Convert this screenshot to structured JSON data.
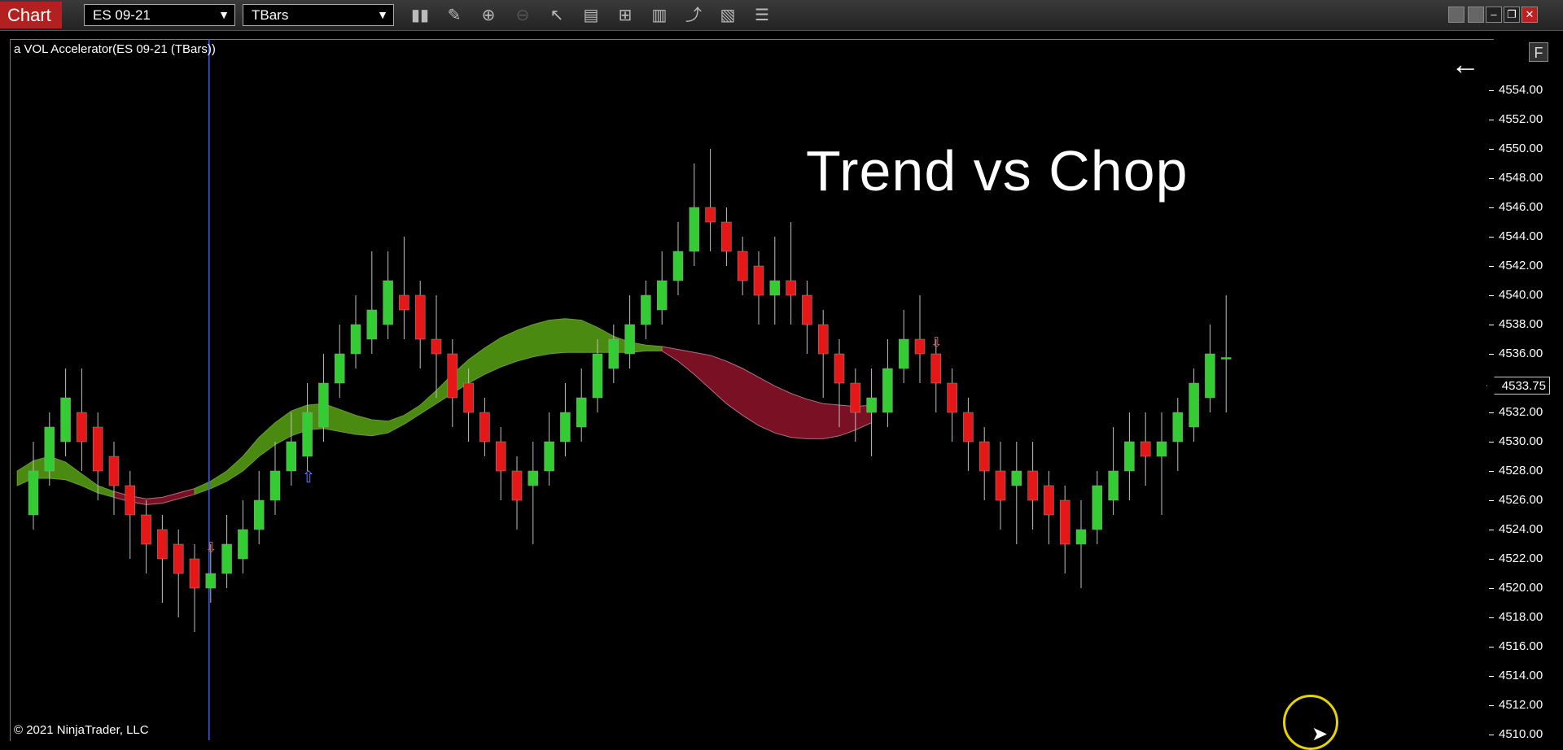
{
  "titlebar": {
    "chart_tab": "Chart",
    "instrument": "ES 09-21",
    "bar_type": "TBars",
    "tools": [
      "bar-style-icon",
      "draw-pencil-icon",
      "zoom-in-icon",
      "zoom-out-icon",
      "pointer-icon",
      "data-box-icon",
      "properties-icon",
      "chart-style-icon",
      "indicators-icon",
      "strategies-icon",
      "menu-lines-icon"
    ]
  },
  "indicator_label": "a VOL Accelerator(ES 09-21 (TBars))",
  "copyright": "© 2021 NinjaTrader, LLC",
  "main_title": "Trend vs Chop",
  "f_button": "F",
  "price_axis": {
    "ticks": [
      "4554.00",
      "4552.00",
      "4550.00",
      "4548.00",
      "4546.00",
      "4544.00",
      "4542.00",
      "4540.00",
      "4538.00",
      "4536.00",
      "4534.00",
      "4532.00",
      "4530.00",
      "4528.00",
      "4526.00",
      "4524.00",
      "4522.00",
      "4520.00",
      "4518.00",
      "4516.00",
      "4514.00",
      "4512.00",
      "4510.00"
    ],
    "last_price": "4533.75"
  },
  "colors": {
    "up": "#33cc33",
    "down": "#e61717",
    "band_up": "#4a8a10",
    "band_down": "#7a1024",
    "cursor_line": "#3b5bff",
    "accent": "#b32020"
  },
  "chart_data": {
    "type": "candlestick",
    "y_range": [
      4510,
      4556
    ],
    "candles": [
      {
        "o": 4525,
        "c": 4528,
        "h": 4530,
        "l": 4524
      },
      {
        "o": 4528,
        "c": 4531,
        "h": 4532,
        "l": 4527
      },
      {
        "o": 4530,
        "c": 4533,
        "h": 4535,
        "l": 4529
      },
      {
        "o": 4532,
        "c": 4530,
        "h": 4535,
        "l": 4528
      },
      {
        "o": 4531,
        "c": 4528,
        "h": 4532,
        "l": 4526
      },
      {
        "o": 4529,
        "c": 4527,
        "h": 4530,
        "l": 4525
      },
      {
        "o": 4527,
        "c": 4525,
        "h": 4528,
        "l": 4522
      },
      {
        "o": 4525,
        "c": 4523,
        "h": 4526,
        "l": 4521
      },
      {
        "o": 4524,
        "c": 4522,
        "h": 4525,
        "l": 4519
      },
      {
        "o": 4523,
        "c": 4521,
        "h": 4524,
        "l": 4518
      },
      {
        "o": 4522,
        "c": 4520,
        "h": 4523,
        "l": 4517
      },
      {
        "o": 4520,
        "c": 4521,
        "h": 4523,
        "l": 4519
      },
      {
        "o": 4521,
        "c": 4523,
        "h": 4525,
        "l": 4520
      },
      {
        "o": 4522,
        "c": 4524,
        "h": 4526,
        "l": 4521
      },
      {
        "o": 4524,
        "c": 4526,
        "h": 4528,
        "l": 4523
      },
      {
        "o": 4526,
        "c": 4528,
        "h": 4530,
        "l": 4525
      },
      {
        "o": 4528,
        "c": 4530,
        "h": 4532,
        "l": 4527
      },
      {
        "o": 4529,
        "c": 4532,
        "h": 4534,
        "l": 4528
      },
      {
        "o": 4531,
        "c": 4534,
        "h": 4536,
        "l": 4530
      },
      {
        "o": 4534,
        "c": 4536,
        "h": 4538,
        "l": 4533
      },
      {
        "o": 4536,
        "c": 4538,
        "h": 4540,
        "l": 4535
      },
      {
        "o": 4537,
        "c": 4539,
        "h": 4543,
        "l": 4536
      },
      {
        "o": 4538,
        "c": 4541,
        "h": 4543,
        "l": 4537
      },
      {
        "o": 4540,
        "c": 4539,
        "h": 4544,
        "l": 4537
      },
      {
        "o": 4540,
        "c": 4537,
        "h": 4541,
        "l": 4535
      },
      {
        "o": 4537,
        "c": 4536,
        "h": 4540,
        "l": 4533
      },
      {
        "o": 4536,
        "c": 4533,
        "h": 4537,
        "l": 4531
      },
      {
        "o": 4534,
        "c": 4532,
        "h": 4535,
        "l": 4530
      },
      {
        "o": 4532,
        "c": 4530,
        "h": 4533,
        "l": 4529
      },
      {
        "o": 4530,
        "c": 4528,
        "h": 4531,
        "l": 4526
      },
      {
        "o": 4528,
        "c": 4526,
        "h": 4529,
        "l": 4524
      },
      {
        "o": 4527,
        "c": 4528,
        "h": 4530,
        "l": 4523
      },
      {
        "o": 4528,
        "c": 4530,
        "h": 4532,
        "l": 4527
      },
      {
        "o": 4530,
        "c": 4532,
        "h": 4534,
        "l": 4529
      },
      {
        "o": 4531,
        "c": 4533,
        "h": 4535,
        "l": 4530
      },
      {
        "o": 4533,
        "c": 4536,
        "h": 4537,
        "l": 4532
      },
      {
        "o": 4535,
        "c": 4537,
        "h": 4538,
        "l": 4534
      },
      {
        "o": 4536,
        "c": 4538,
        "h": 4540,
        "l": 4535
      },
      {
        "o": 4538,
        "c": 4540,
        "h": 4541,
        "l": 4537
      },
      {
        "o": 4539,
        "c": 4541,
        "h": 4543,
        "l": 4538
      },
      {
        "o": 4541,
        "c": 4543,
        "h": 4545,
        "l": 4540
      },
      {
        "o": 4543,
        "c": 4546,
        "h": 4549,
        "l": 4542
      },
      {
        "o": 4546,
        "c": 4545,
        "h": 4550,
        "l": 4543
      },
      {
        "o": 4545,
        "c": 4543,
        "h": 4546,
        "l": 4542
      },
      {
        "o": 4543,
        "c": 4541,
        "h": 4544,
        "l": 4540
      },
      {
        "o": 4542,
        "c": 4540,
        "h": 4543,
        "l": 4538
      },
      {
        "o": 4540,
        "c": 4541,
        "h": 4544,
        "l": 4538
      },
      {
        "o": 4541,
        "c": 4540,
        "h": 4545,
        "l": 4538
      },
      {
        "o": 4540,
        "c": 4538,
        "h": 4541,
        "l": 4536
      },
      {
        "o": 4538,
        "c": 4536,
        "h": 4539,
        "l": 4533
      },
      {
        "o": 4536,
        "c": 4534,
        "h": 4537,
        "l": 4531
      },
      {
        "o": 4534,
        "c": 4532,
        "h": 4535,
        "l": 4530
      },
      {
        "o": 4532,
        "c": 4533,
        "h": 4535,
        "l": 4529
      },
      {
        "o": 4532,
        "c": 4535,
        "h": 4537,
        "l": 4531
      },
      {
        "o": 4535,
        "c": 4537,
        "h": 4539,
        "l": 4534
      },
      {
        "o": 4537,
        "c": 4536,
        "h": 4540,
        "l": 4534
      },
      {
        "o": 4536,
        "c": 4534,
        "h": 4537,
        "l": 4532
      },
      {
        "o": 4534,
        "c": 4532,
        "h": 4535,
        "l": 4530
      },
      {
        "o": 4532,
        "c": 4530,
        "h": 4533,
        "l": 4528
      },
      {
        "o": 4530,
        "c": 4528,
        "h": 4531,
        "l": 4526
      },
      {
        "o": 4528,
        "c": 4526,
        "h": 4530,
        "l": 4524
      },
      {
        "o": 4527,
        "c": 4528,
        "h": 4530,
        "l": 4523
      },
      {
        "o": 4528,
        "c": 4526,
        "h": 4530,
        "l": 4524
      },
      {
        "o": 4527,
        "c": 4525,
        "h": 4528,
        "l": 4523
      },
      {
        "o": 4526,
        "c": 4523,
        "h": 4527,
        "l": 4521
      },
      {
        "o": 4523,
        "c": 4524,
        "h": 4526,
        "l": 4520
      },
      {
        "o": 4524,
        "c": 4527,
        "h": 4528,
        "l": 4523
      },
      {
        "o": 4526,
        "c": 4528,
        "h": 4531,
        "l": 4525
      },
      {
        "o": 4528,
        "c": 4530,
        "h": 4532,
        "l": 4526
      },
      {
        "o": 4530,
        "c": 4529,
        "h": 4532,
        "l": 4527
      },
      {
        "o": 4529,
        "c": 4530,
        "h": 4532,
        "l": 4525
      },
      {
        "o": 4530,
        "c": 4532,
        "h": 4533,
        "l": 4528
      },
      {
        "o": 4531,
        "c": 4534,
        "h": 4535,
        "l": 4530
      },
      {
        "o": 4533,
        "c": 4536,
        "h": 4538,
        "l": 4532
      },
      {
        "o": 4535.75,
        "c": 4535.75,
        "h": 4540,
        "l": 4532
      }
    ],
    "band": {
      "segments": [
        {
          "state": "up",
          "values": [
            [
              4527,
              4528
            ],
            [
              4527.5,
              4528.7
            ],
            [
              4527.5,
              4529
            ],
            [
              4527.4,
              4528.6
            ],
            [
              4527,
              4527.8
            ],
            [
              4526.5,
              4527
            ],
            [
              4526.2,
              4526.6
            ]
          ]
        },
        {
          "state": "down",
          "values": [
            [
              4526.2,
              4526.6
            ],
            [
              4525.9,
              4526.3
            ],
            [
              4525.7,
              4526.1
            ],
            [
              4525.8,
              4526.2
            ],
            [
              4526.1,
              4526.5
            ],
            [
              4526.4,
              4526.8
            ]
          ]
        },
        {
          "state": "up",
          "values": [
            [
              4526.4,
              4526.8
            ],
            [
              4526.8,
              4527.3
            ],
            [
              4527.3,
              4528
            ],
            [
              4528,
              4529
            ],
            [
              4529,
              4530.3
            ],
            [
              4529.8,
              4531.3
            ],
            [
              4530.4,
              4532.1
            ],
            [
              4530.8,
              4532.5
            ],
            [
              4530.9,
              4532.6
            ],
            [
              4530.7,
              4532.2
            ],
            [
              4530.5,
              4531.8
            ],
            [
              4530.4,
              4531.5
            ],
            [
              4530.6,
              4531.4
            ],
            [
              4531.2,
              4531.8
            ],
            [
              4531.9,
              4532.5
            ],
            [
              4532.6,
              4533.5
            ],
            [
              4533.3,
              4534.6
            ],
            [
              4534,
              4535.6
            ],
            [
              4534.6,
              4536.4
            ],
            [
              4535.1,
              4537.1
            ],
            [
              4535.5,
              4537.6
            ],
            [
              4535.8,
              4538
            ],
            [
              4536,
              4538.3
            ],
            [
              4536.1,
              4538.4
            ],
            [
              4536.1,
              4538.3
            ],
            [
              4536.1,
              4537.8
            ],
            [
              4536.1,
              4537.2
            ],
            [
              4536.1,
              4536.8
            ],
            [
              4536.2,
              4536.6
            ],
            [
              4536.2,
              4536.5
            ]
          ]
        },
        {
          "state": "down",
          "values": [
            [
              4536.2,
              4536.5
            ],
            [
              4535.5,
              4536.3
            ],
            [
              4534.6,
              4536.1
            ],
            [
              4533.6,
              4535.9
            ],
            [
              4532.6,
              4535.5
            ],
            [
              4531.8,
              4535
            ],
            [
              4531.1,
              4534.4
            ],
            [
              4530.6,
              4533.8
            ],
            [
              4530.3,
              4533.3
            ],
            [
              4530.2,
              4532.9
            ],
            [
              4530.2,
              4532.6
            ],
            [
              4530.4,
              4532.5
            ],
            [
              4530.8,
              4532.4
            ],
            [
              4531.3,
              4532.5
            ]
          ]
        }
      ]
    },
    "signals": [
      {
        "bar": 11,
        "type": "down-arrow"
      },
      {
        "bar": 17,
        "type": "up-arrow"
      },
      {
        "bar": 56,
        "type": "down-arrow"
      }
    ],
    "vertical_line_bar": 11
  }
}
